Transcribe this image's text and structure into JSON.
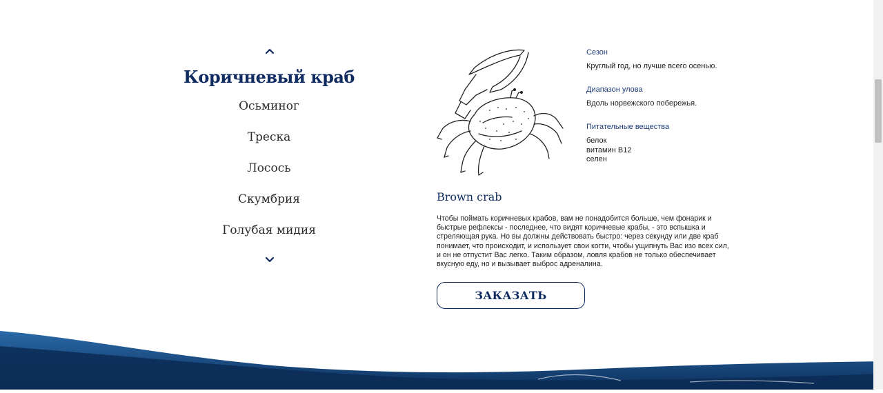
{
  "species_nav": {
    "up_icon": "chevron-up-icon",
    "down_icon": "chevron-down-icon",
    "active": "Коричневый краб",
    "items": [
      "Осьминог",
      "Треска",
      "Лосось",
      "Скумбрия",
      "Голубая мидия"
    ]
  },
  "details": {
    "season_label": "Сезон",
    "season_value": "Круглый год, но лучше всего осенью.",
    "range_label": "Диапазон улова",
    "range_value": "Вдоль норвежского побережья.",
    "nutrients_label": "Питательные вещества",
    "nutrients": [
      "белок",
      "витамин B12",
      "селен"
    ]
  },
  "product": {
    "name": "Brown crab",
    "description": "Чтобы поймать коричневых крабов, вам не понадобится больше, чем фонарик и быстрые рефлексы - последнее, что видят коричневые крабы, - это вспышка и стреляющая рука. Но вы должны действовать быстро: через секунду или две краб понимает, что происходит, и использует свои когти, чтобы ущипнуть Вас изо всех сил, и он не отпустит Вас легко. Таким образом, ловля крабов не только обеспечивает вкусную еду, но и вызывает выброс адреналина.",
    "order_label": "ЗАКАЗАТЬ"
  },
  "colors": {
    "brand": "#0e2a5f",
    "accent_label": "#1d3b7a",
    "wave": "#1a4f8a"
  }
}
